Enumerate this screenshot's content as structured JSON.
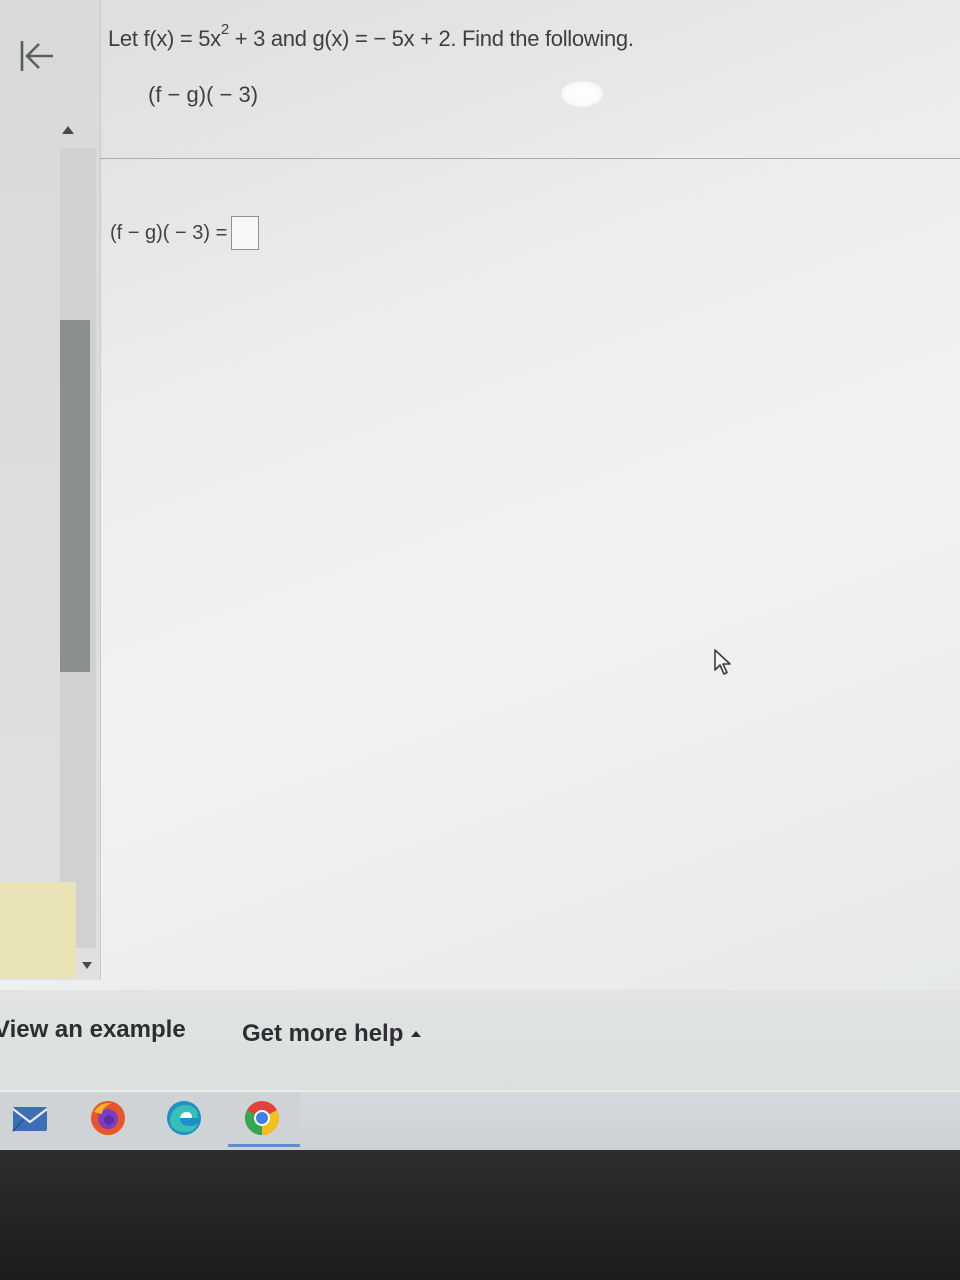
{
  "problem": {
    "prefix": "Let f(x) = 5x",
    "exponent": "2",
    "suffix": " + 3 and g(x) = − 5x + 2. Find the following.",
    "expression": "(f − g)( − 3)"
  },
  "answer": {
    "label": "(f − g)( − 3) =",
    "value": ""
  },
  "help_bar": {
    "view_example": "View an example",
    "get_more_help": "Get more help"
  },
  "icons": {
    "back": "first-page-icon",
    "mail": "mail-icon",
    "firefox": "firefox-icon",
    "edge": "edge-icon",
    "chrome": "chrome-icon",
    "pointer": "mouse-pointer-icon"
  },
  "colors": {
    "text": "#3d3f42",
    "help_text": "#2c2e31",
    "scroll_thumb": "#8c8f90",
    "taskbar_active": "#5b8fd1"
  }
}
